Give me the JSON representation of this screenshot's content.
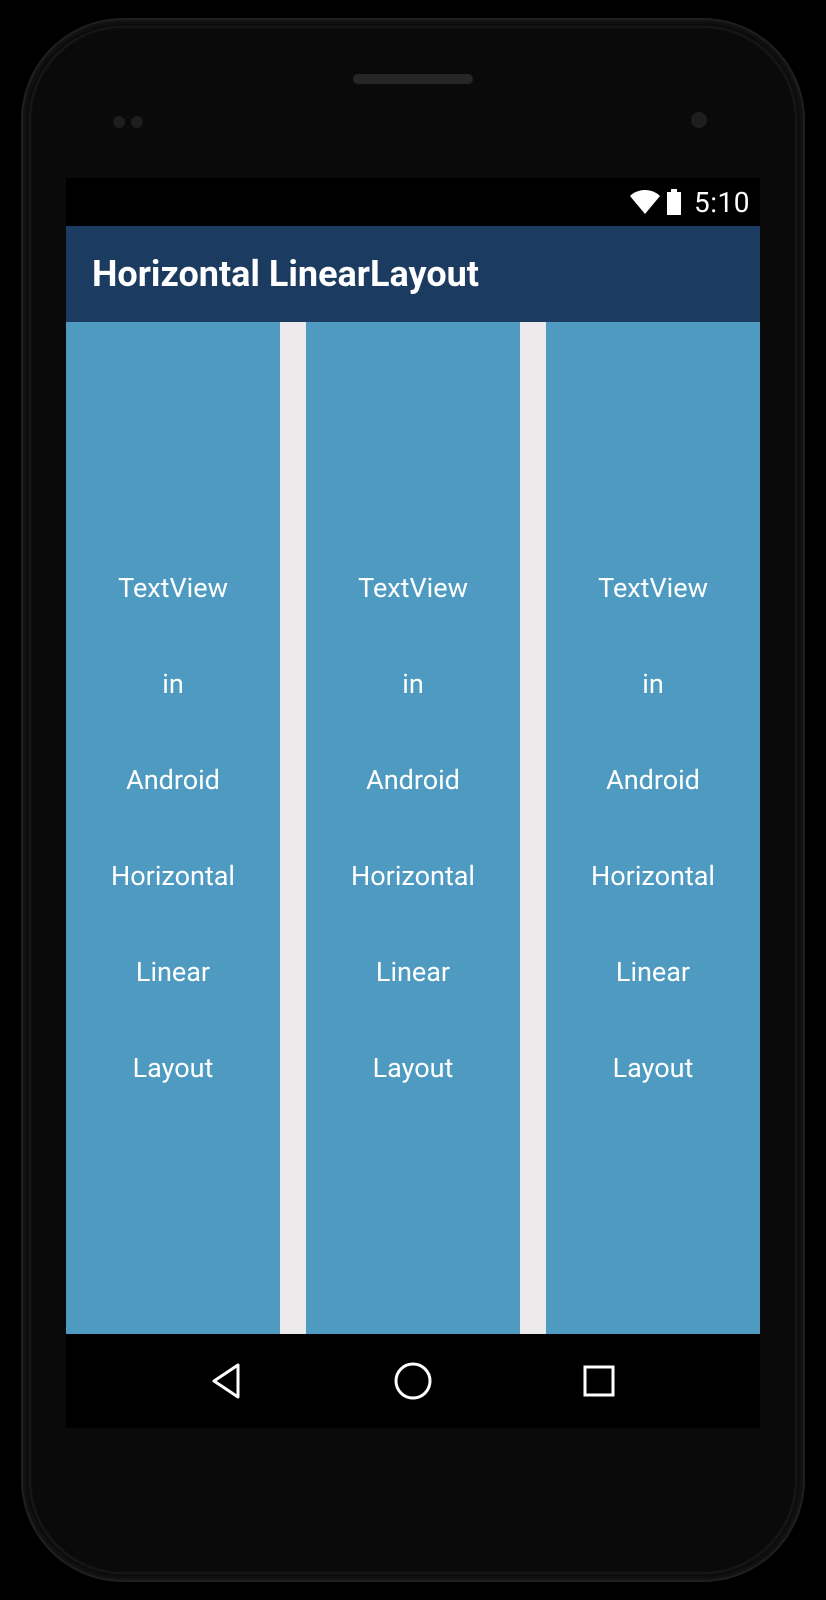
{
  "status": {
    "time": "5:10"
  },
  "appbar": {
    "title": "Horizontal LinearLayout"
  },
  "columns": [
    {
      "lines": [
        "TextView",
        "in",
        "Android",
        "Horizontal",
        "Linear",
        "Layout"
      ]
    },
    {
      "lines": [
        "TextView",
        "in",
        "Android",
        "Horizontal",
        "Linear",
        "Layout"
      ]
    },
    {
      "lines": [
        "TextView",
        "in",
        "Android",
        "Horizontal",
        "Linear",
        "Layout"
      ]
    }
  ],
  "colors": {
    "appbar": "#1c3b61",
    "column": "#4e9ac1",
    "gap": "#eceaea"
  }
}
